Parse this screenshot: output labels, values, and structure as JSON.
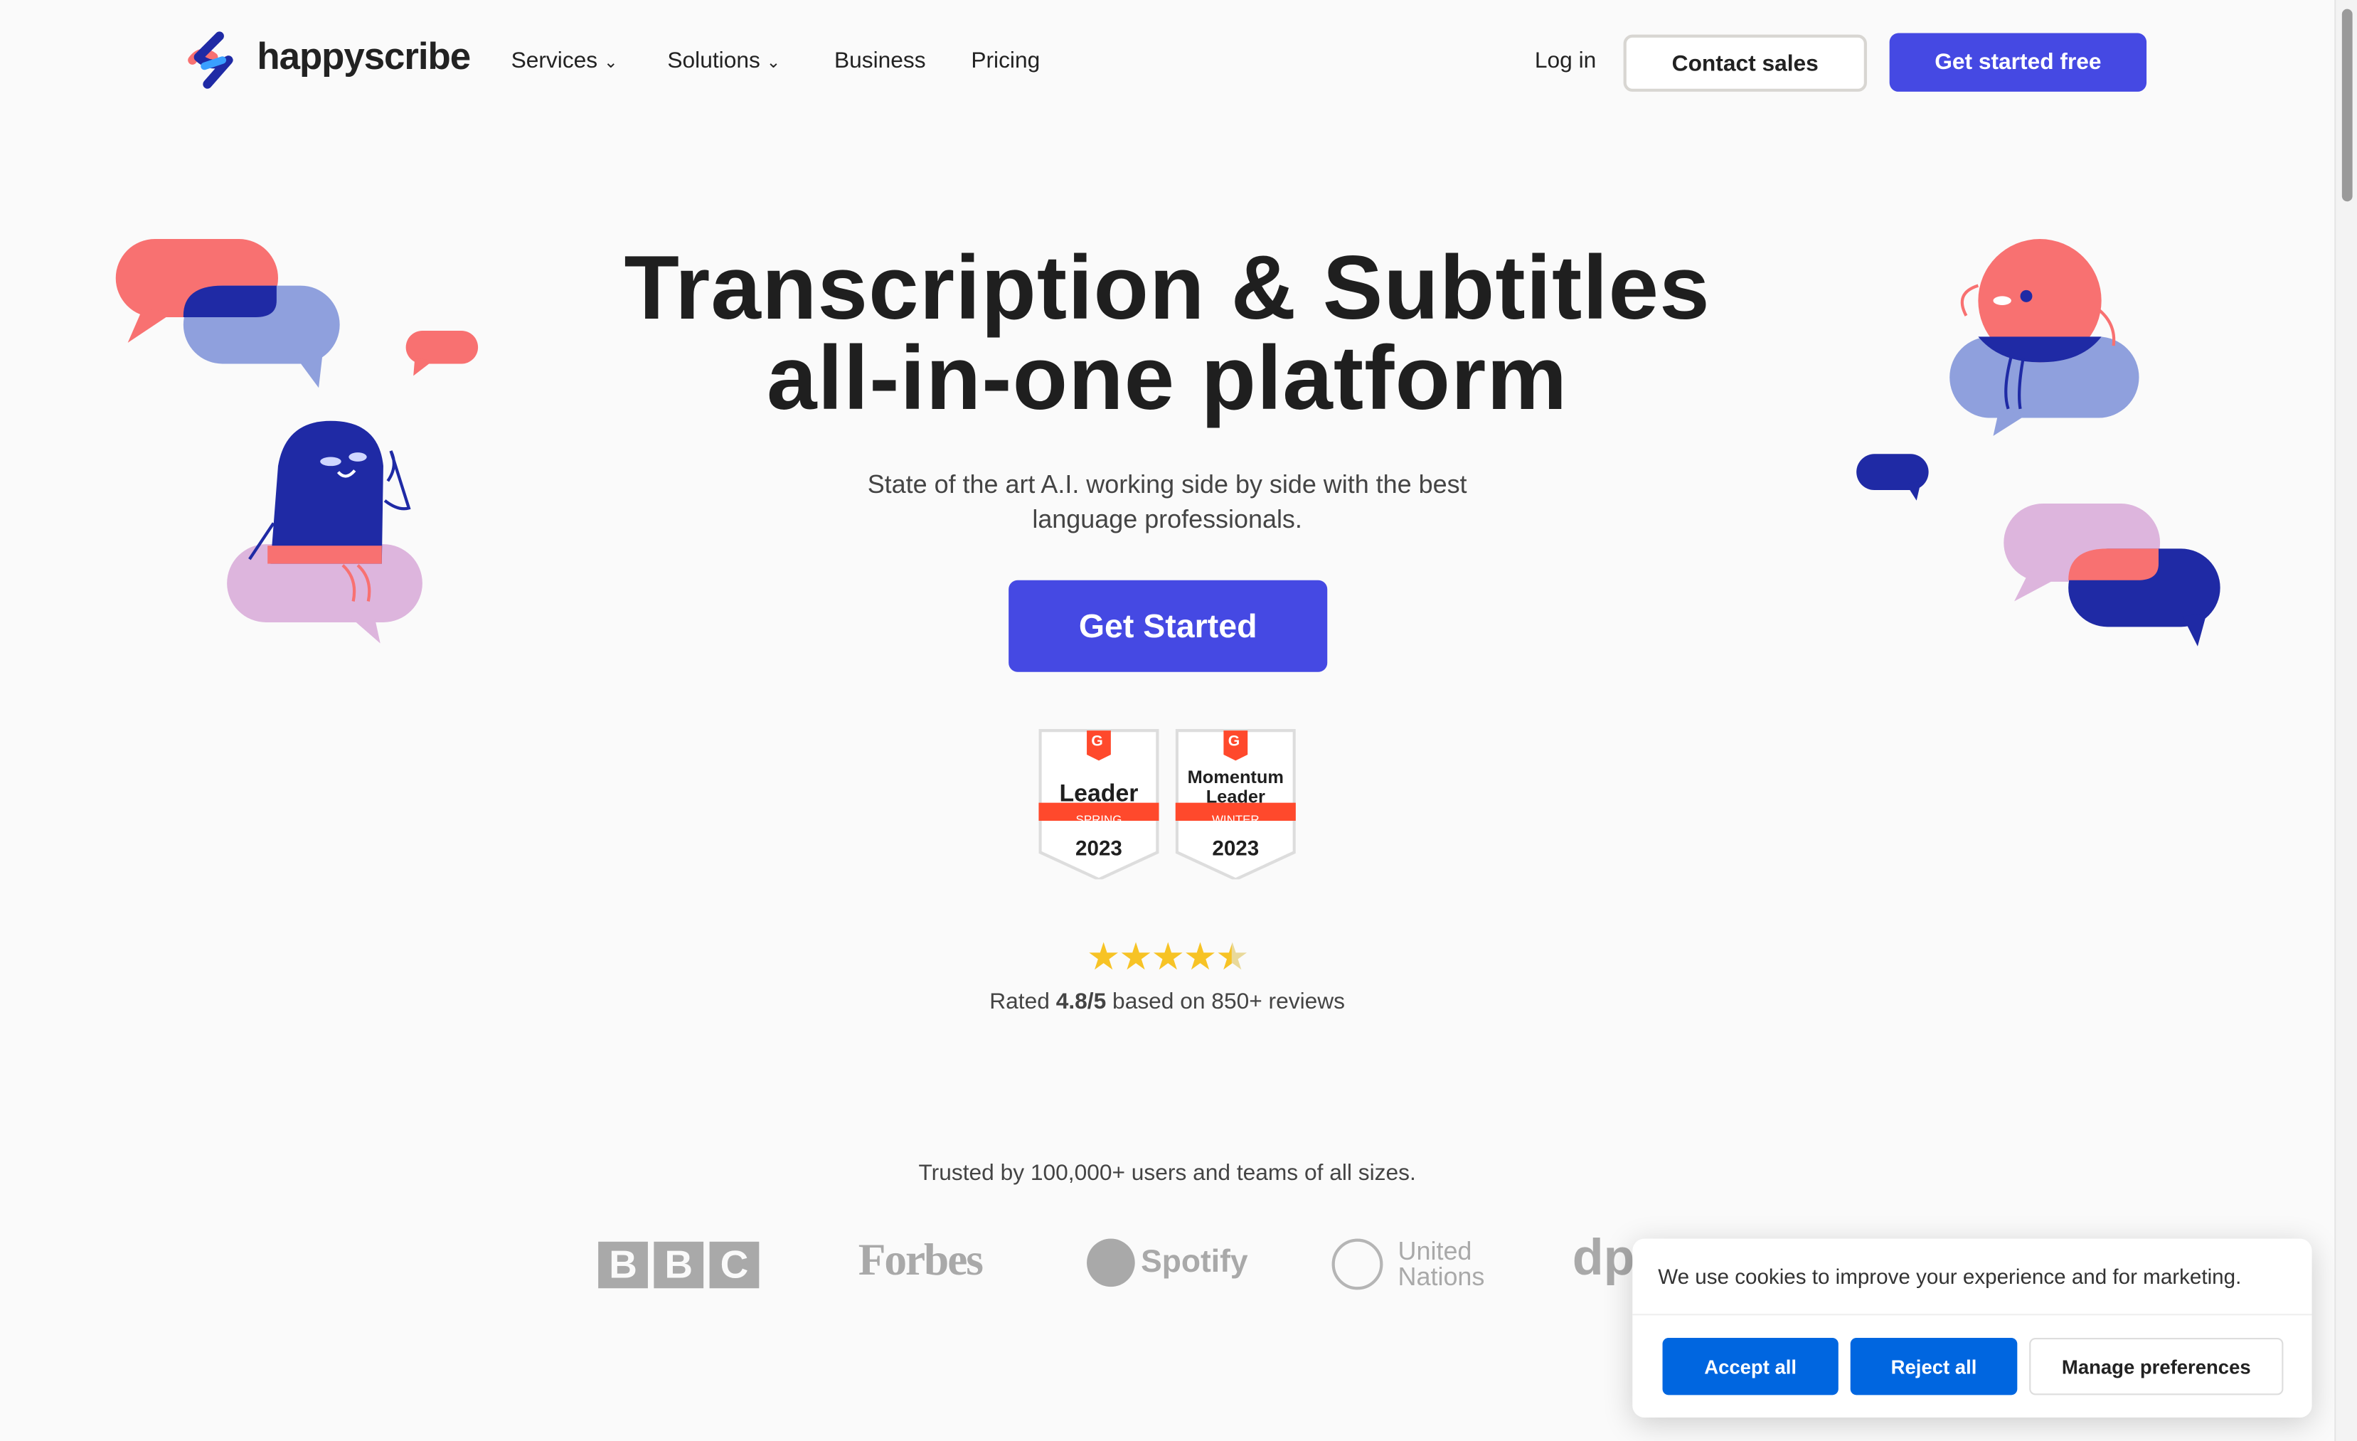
{
  "header": {
    "brand": "happyscribe",
    "nav": [
      {
        "label": "Services",
        "has_dropdown": true
      },
      {
        "label": "Solutions",
        "has_dropdown": true
      },
      {
        "label": "Business",
        "has_dropdown": false
      },
      {
        "label": "Pricing",
        "has_dropdown": false
      }
    ],
    "login_label": "Log in",
    "contact_label": "Contact sales",
    "cta_label": "Get started free"
  },
  "hero": {
    "title_line1": "Transcription & Subtitles",
    "title_line2": "all-in-one platform",
    "subtitle_line1": "State of the art A.I. working side by side with the best",
    "subtitle_line2": "language professionals.",
    "cta_label": "Get Started"
  },
  "badges": [
    {
      "title1": "",
      "title2": "Leader",
      "season": "SPRING",
      "year": "2023"
    },
    {
      "title1": "Momentum",
      "title2": "Leader",
      "season": "WINTER",
      "year": "2023"
    }
  ],
  "rating": {
    "stars": 4.5,
    "prefix": "Rated",
    "score": "4.8/5",
    "suffix": "based on 850+ reviews"
  },
  "trusted": {
    "text": "Trusted by 100,000+ users and teams of all sizes.",
    "logos": [
      "BBC",
      "Forbes",
      "Spotify",
      "United",
      "Nations",
      "dp"
    ]
  },
  "cookie": {
    "message": "We use cookies to improve your experience and for marketing.",
    "accept_label": "Accept all",
    "reject_label": "Reject all",
    "manage_label": "Manage preferences"
  },
  "colors": {
    "primary": "#4549e3",
    "coral": "#f87171",
    "navy": "#1f2aa5",
    "lavender": "#8fa0dd",
    "pink": "#ddb5dd",
    "cookie_blue": "#0066e0",
    "g2_red": "#ff492c",
    "star": "#f7c325"
  }
}
